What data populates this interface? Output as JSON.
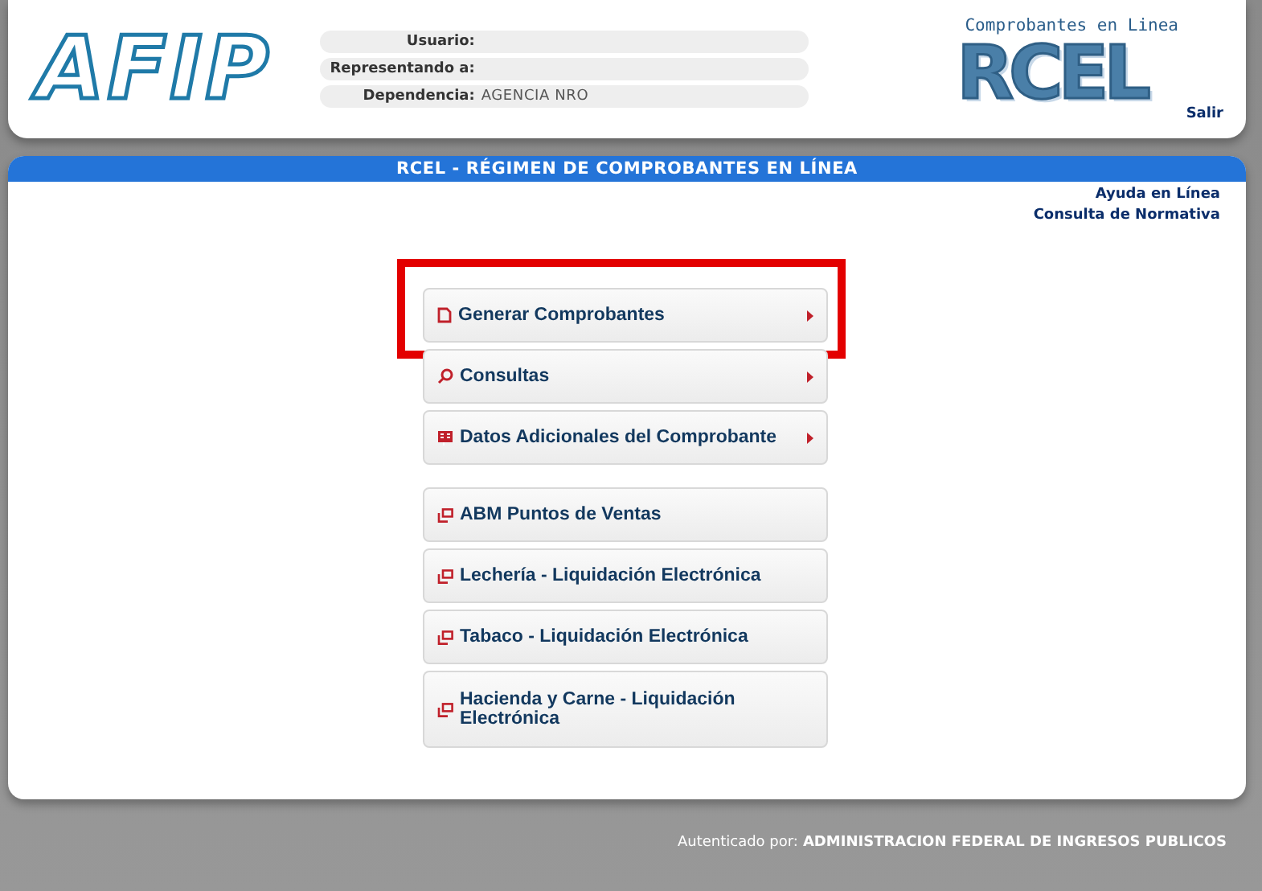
{
  "header": {
    "logo": "AFIP",
    "fields": [
      {
        "label": "Usuario:"
      },
      {
        "label": "Representando a:"
      },
      {
        "label": "Dependencia:",
        "value": "AGENCIA NRO"
      }
    ],
    "brand_caption": "Comprobantes en Linea",
    "brand": "RCEL",
    "logout": "Salir"
  },
  "title": "RCEL - RÉGIMEN DE COMPROBANTES EN LÍNEA",
  "links": [
    "Ayuda en Línea",
    "Consulta de Normativa"
  ],
  "menu": [
    {
      "label": "Generar Comprobantes",
      "kind": "document",
      "submenu": true,
      "highlighted": true
    },
    {
      "label": "Consultas",
      "kind": "search",
      "submenu": true,
      "highlighted": false
    },
    {
      "label": "Datos Adicionales del Comprobante",
      "kind": "form",
      "submenu": true,
      "highlighted": false
    },
    {
      "label": "ABM Puntos de Ventas",
      "kind": "window",
      "submenu": false,
      "highlighted": false
    },
    {
      "label": "Lechería - Liquidación Electrónica",
      "kind": "window",
      "submenu": false,
      "highlighted": false
    },
    {
      "label": "Tabaco - Liquidación Electrónica",
      "kind": "window",
      "submenu": false,
      "highlighted": false
    },
    {
      "label": "Hacienda y Carne - Liquidación Electrónica",
      "kind": "window",
      "submenu": false,
      "highlighted": false
    }
  ],
  "footer": {
    "label": "Autenticado por:",
    "value": "ADMINISTRACION FEDERAL DE INGRESOS PUBLICOS"
  }
}
